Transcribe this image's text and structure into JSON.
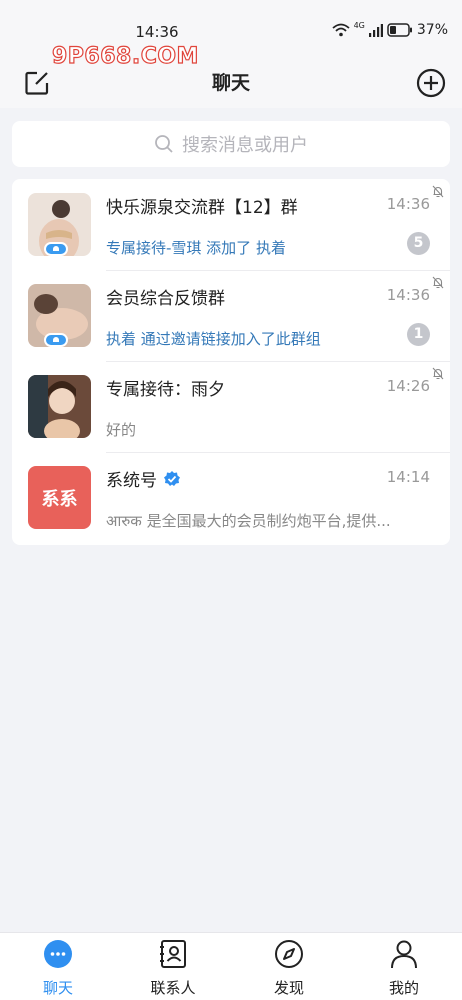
{
  "status_bar": {
    "time": "14:36",
    "battery": "37%",
    "network": "4G"
  },
  "watermark": "9P668.COM",
  "header": {
    "title": "聊天"
  },
  "search": {
    "placeholder": "搜索消息或用户"
  },
  "conversations": [
    {
      "name": "快乐源泉交流群【12】群",
      "time": "14:36",
      "preview": "专属接待-雪琪 添加了 执着",
      "unread": "5",
      "muted": true
    },
    {
      "name": "会员综合反馈群",
      "time": "14:36",
      "preview": "执着 通过邀请链接加入了此群组",
      "unread": "1",
      "muted": true
    },
    {
      "name": "专属接待：雨夕",
      "time": "14:26",
      "preview": "好的",
      "muted": true
    },
    {
      "name": "系统号",
      "time": "14:14",
      "preview": "आरुक 是全国最大的会员制约炮平台,提供...",
      "avatar_text": "系系",
      "verified": true
    }
  ],
  "tabbar": [
    {
      "label": "聊天",
      "icon": "chat-icon",
      "active": true
    },
    {
      "label": "联系人",
      "icon": "contacts-icon"
    },
    {
      "label": "发现",
      "icon": "compass-icon"
    },
    {
      "label": "我的",
      "icon": "user-icon"
    }
  ],
  "colors": {
    "accent": "#2f8ff0",
    "preview_link": "#3579b8",
    "system_avatar": "#e8615a"
  }
}
